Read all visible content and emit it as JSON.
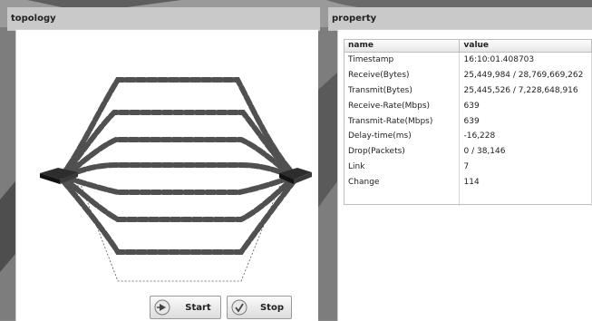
{
  "topology": {
    "title": "topology",
    "start_label": "Start",
    "stop_label": "Stop"
  },
  "property": {
    "title": "property",
    "columns": [
      "name",
      "value"
    ],
    "rows": [
      {
        "name": "Timestamp",
        "value": "16:10:01.408703"
      },
      {
        "name": "Receive(Bytes)",
        "value": "25,449,984 / 28,769,669,262"
      },
      {
        "name": "Transmit(Bytes)",
        "value": "25,445,526 / 7,228,648,916"
      },
      {
        "name": "Receive-Rate(Mbps)",
        "value": "639"
      },
      {
        "name": "Transmit-Rate(Mbps)",
        "value": "639"
      },
      {
        "name": "Delay-time(ms)",
        "value": "-16,228"
      },
      {
        "name": "Drop(Packets)",
        "value": "0 / 38,146"
      },
      {
        "name": "Link",
        "value": "7"
      },
      {
        "name": "Change",
        "value": "114"
      }
    ]
  },
  "colors": {
    "panel_header": "#c9c9c9",
    "link_dash": "#505050",
    "device": "#2d2d2d"
  },
  "icons": {
    "start": "play-arrow-icon",
    "stop": "stop-check-icon",
    "device": "network-switch-icon"
  }
}
